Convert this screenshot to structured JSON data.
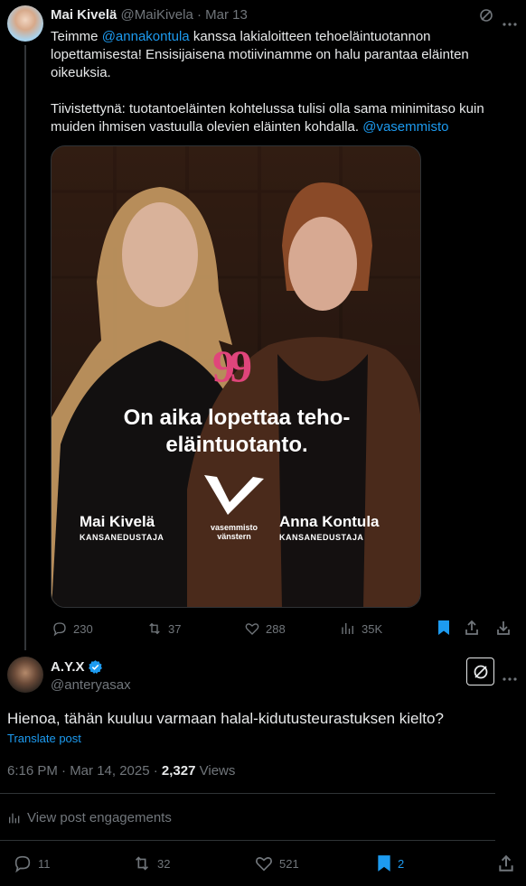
{
  "tweet1": {
    "author_name": "Mai Kivelä",
    "author_handle": "@MaiKivela",
    "separator": "·",
    "date": "Mar 13",
    "text_part1": "Teimme ",
    "mention1": "@annakontula",
    "text_part2": " kanssa lakialoitteen tehoeläintuotannon lopettamisesta! Ensisijaisena motiivinamme on halu parantaa eläinten oikeuksia.",
    "text_para2": "Tiivistettynä: tuotantoeläinten kohtelussa tulisi olla sama minimitaso kuin muiden ihmisen vastuulla olevien eläinten kohdalla. ",
    "mention2": "@vasemmisto",
    "image": {
      "quote_mark": "99",
      "headline_line1": "On aika lopettaa teho-",
      "headline_line2": "eläintuotanto.",
      "left_name": "Mai Kivelä",
      "left_role": "KANSANEDUSTAJA",
      "right_name": "Anna Kontula",
      "right_role": "KANSANEDUSTAJA",
      "logo_line1": "vasemmisto",
      "logo_line2": "vänstern"
    },
    "actions": {
      "replies": "230",
      "reposts": "37",
      "likes": "288",
      "views": "35K"
    }
  },
  "tweet2": {
    "author_name": "A.Y.X",
    "author_handle": "@anteryasax",
    "text": "Hienoa, tähän kuuluu varmaan halal-kidutusteurastuksen kielto?",
    "translate": "Translate post",
    "time": "6:16 PM · Mar 14, 2025 · ",
    "views_count": "2,327",
    "views_label": " Views",
    "engagements": "View post engagements",
    "actions": {
      "replies": "11",
      "reposts": "32",
      "likes": "521",
      "bookmarks": "2"
    }
  },
  "colors": {
    "accent": "#1d9bf0",
    "quote_pink": "#e0457b",
    "muted": "#71767b"
  }
}
